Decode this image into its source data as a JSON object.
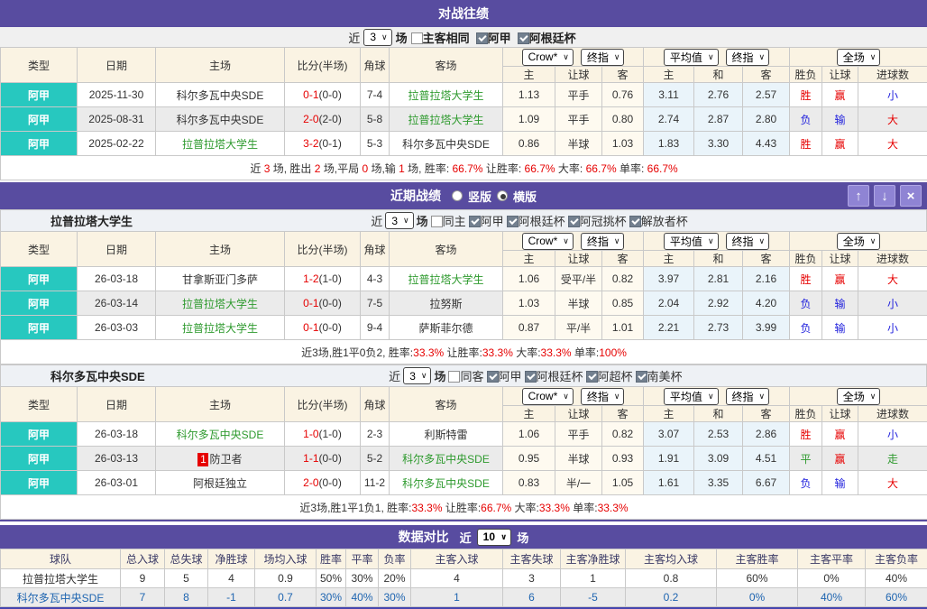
{
  "colors": {
    "purple": "#584CA0",
    "teal": "#27C8BF",
    "red": "#E60000",
    "blue": "#2222DD",
    "green": "#2E9A2E",
    "header_beige": "#FAF3E3",
    "odds_col": "#FEFAF0",
    "avg_col": "#EAF4FA",
    "alt_row": "#EBEBEB",
    "compare_away_text": "#1D64B0"
  },
  "table_headers": {
    "left": [
      "类型",
      "日期",
      "主场",
      "比分(半场)",
      "角球",
      "客场"
    ],
    "right": [
      "主",
      "让球",
      "客",
      "主",
      "和",
      "客",
      "胜负",
      "让球",
      "进球数"
    ]
  },
  "selects": {
    "book": "Crow*",
    "final1": "终指",
    "avg": "平均值",
    "final2": "终指",
    "scope": "全场"
  },
  "h2h": {
    "title": "对战往绩",
    "controls": {
      "prefix": "近",
      "count": "3",
      "suffix": "场",
      "checks": [
        {
          "label": "主客相同",
          "checked": false
        },
        {
          "label": "阿甲",
          "checked": true
        },
        {
          "label": "阿根廷杯",
          "checked": true
        }
      ]
    },
    "rows": [
      {
        "type": "阿甲",
        "date": "2025-11-30",
        "home": {
          "name": "科尔多瓦中央SDE",
          "green": false
        },
        "score": "0-1",
        "half": "(0-0)",
        "corner": "7-4",
        "away": {
          "name": "拉普拉塔大学生",
          "green": true
        },
        "odds": [
          "1.13",
          "平手",
          "0.76"
        ],
        "avg": [
          "3.11",
          "2.76",
          "2.57"
        ],
        "results": [
          {
            "t": "胜",
            "c": "red"
          },
          {
            "t": "赢",
            "c": "red"
          },
          {
            "t": "小",
            "c": "blue"
          }
        ]
      },
      {
        "type": "阿甲",
        "date": "2025-08-31",
        "home": {
          "name": "科尔多瓦中央SDE",
          "green": false
        },
        "score": "2-0",
        "half": "(2-0)",
        "corner": "5-8",
        "away": {
          "name": "拉普拉塔大学生",
          "green": true
        },
        "odds": [
          "1.09",
          "平手",
          "0.80"
        ],
        "avg": [
          "2.74",
          "2.87",
          "2.80"
        ],
        "results": [
          {
            "t": "负",
            "c": "blue"
          },
          {
            "t": "输",
            "c": "blue"
          },
          {
            "t": "大",
            "c": "red"
          }
        ]
      },
      {
        "type": "阿甲",
        "date": "2025-02-22",
        "home": {
          "name": "拉普拉塔大学生",
          "green": true
        },
        "score": "3-2",
        "half": "(0-1)",
        "corner": "5-3",
        "away": {
          "name": "科尔多瓦中央SDE",
          "green": false
        },
        "odds": [
          "0.86",
          "半球",
          "1.03"
        ],
        "avg": [
          "1.83",
          "3.30",
          "4.43"
        ],
        "results": [
          {
            "t": "胜",
            "c": "red"
          },
          {
            "t": "赢",
            "c": "red"
          },
          {
            "t": "大",
            "c": "red"
          }
        ]
      }
    ],
    "summary": [
      {
        "t": "近 ",
        "r": false
      },
      {
        "t": "3",
        "r": true
      },
      {
        "t": " 场, 胜出 ",
        "r": false
      },
      {
        "t": "2",
        "r": true
      },
      {
        "t": " 场,平局 ",
        "r": false
      },
      {
        "t": "0",
        "r": true
      },
      {
        "t": " 场,输 ",
        "r": false
      },
      {
        "t": "1",
        "r": true
      },
      {
        "t": " 场, 胜率: ",
        "r": false
      },
      {
        "t": "66.7%",
        "r": true
      },
      {
        "t": " 让胜率: ",
        "r": false
      },
      {
        "t": "66.7%",
        "r": true
      },
      {
        "t": " 大率: ",
        "r": false
      },
      {
        "t": "66.7%",
        "r": true
      },
      {
        "t": " 单率: ",
        "r": false
      },
      {
        "t": "66.7%",
        "r": true
      }
    ]
  },
  "recent": {
    "title": "近期战绩",
    "radios": [
      {
        "label": "竖版",
        "selected": false
      },
      {
        "label": "横版",
        "selected": true
      }
    ],
    "buttons": [
      {
        "name": "move-up-button",
        "glyph": "↑"
      },
      {
        "name": "move-down-button",
        "glyph": "↓"
      },
      {
        "name": "close-button",
        "glyph": "×"
      }
    ],
    "teams": [
      {
        "name": "拉普拉塔大学生",
        "controls": {
          "prefix": "近",
          "count": "3",
          "suffix": "场",
          "checks": [
            {
              "label": "同主",
              "checked": false
            },
            {
              "label": "阿甲",
              "checked": true
            },
            {
              "label": "阿根廷杯",
              "checked": true
            },
            {
              "label": "阿冠挑杯",
              "checked": true
            },
            {
              "label": "解放者杯",
              "checked": true
            }
          ]
        },
        "rows": [
          {
            "type": "阿甲",
            "date": "26-03-18",
            "home": {
              "name": "甘拿斯亚门多萨",
              "green": false
            },
            "score": "1-2",
            "half": "(1-0)",
            "corner": "4-3",
            "away": {
              "name": "拉普拉塔大学生",
              "green": true
            },
            "odds": [
              "1.06",
              "受平/半",
              "0.82"
            ],
            "avg": [
              "3.97",
              "2.81",
              "2.16"
            ],
            "results": [
              {
                "t": "胜",
                "c": "red"
              },
              {
                "t": "赢",
                "c": "red"
              },
              {
                "t": "大",
                "c": "red"
              }
            ]
          },
          {
            "type": "阿甲",
            "date": "26-03-14",
            "home": {
              "name": "拉普拉塔大学生",
              "green": true
            },
            "score": "0-1",
            "half": "(0-0)",
            "corner": "7-5",
            "away": {
              "name": "拉努斯",
              "green": false
            },
            "odds": [
              "1.03",
              "半球",
              "0.85"
            ],
            "avg": [
              "2.04",
              "2.92",
              "4.20"
            ],
            "results": [
              {
                "t": "负",
                "c": "blue"
              },
              {
                "t": "输",
                "c": "blue"
              },
              {
                "t": "小",
                "c": "blue"
              }
            ]
          },
          {
            "type": "阿甲",
            "date": "26-03-03",
            "home": {
              "name": "拉普拉塔大学生",
              "green": true
            },
            "score": "0-1",
            "half": "(0-0)",
            "corner": "9-4",
            "away": {
              "name": "萨斯菲尔德",
              "green": false
            },
            "odds": [
              "0.87",
              "平/半",
              "1.01"
            ],
            "avg": [
              "2.21",
              "2.73",
              "3.99"
            ],
            "results": [
              {
                "t": "负",
                "c": "blue"
              },
              {
                "t": "输",
                "c": "blue"
              },
              {
                "t": "小",
                "c": "blue"
              }
            ]
          }
        ],
        "summary": [
          {
            "t": "近3场,胜1平0负2, 胜率:",
            "r": false
          },
          {
            "t": "33.3%",
            "r": true
          },
          {
            "t": " 让胜率:",
            "r": false
          },
          {
            "t": "33.3%",
            "r": true
          },
          {
            "t": " 大率:",
            "r": false
          },
          {
            "t": "33.3%",
            "r": true
          },
          {
            "t": " 单率:",
            "r": false
          },
          {
            "t": "100%",
            "r": true
          }
        ]
      },
      {
        "name": "科尔多瓦中央SDE",
        "controls": {
          "prefix": "近",
          "count": "3",
          "suffix": "场",
          "checks": [
            {
              "label": "同客",
              "checked": false
            },
            {
              "label": "阿甲",
              "checked": true
            },
            {
              "label": "阿根廷杯",
              "checked": true
            },
            {
              "label": "阿超杯",
              "checked": true
            },
            {
              "label": "南美杯",
              "checked": true
            }
          ]
        },
        "rows": [
          {
            "type": "阿甲",
            "date": "26-03-18",
            "home": {
              "name": "科尔多瓦中央SDE",
              "green": true
            },
            "score": "1-0",
            "half": "(1-0)",
            "corner": "2-3",
            "away": {
              "name": "利斯特雷",
              "green": false
            },
            "odds": [
              "1.06",
              "平手",
              "0.82"
            ],
            "avg": [
              "3.07",
              "2.53",
              "2.86"
            ],
            "results": [
              {
                "t": "胜",
                "c": "red"
              },
              {
                "t": "赢",
                "c": "red"
              },
              {
                "t": "小",
                "c": "blue"
              }
            ]
          },
          {
            "type": "阿甲",
            "date": "26-03-13",
            "home": {
              "name": "防卫者",
              "green": false,
              "badge": "1"
            },
            "score": "1-1",
            "half": "(0-0)",
            "corner": "5-2",
            "away": {
              "name": "科尔多瓦中央SDE",
              "green": true
            },
            "odds": [
              "0.95",
              "半球",
              "0.93"
            ],
            "avg": [
              "1.91",
              "3.09",
              "4.51"
            ],
            "results": [
              {
                "t": "平",
                "c": "green"
              },
              {
                "t": "赢",
                "c": "red"
              },
              {
                "t": "走",
                "c": "green"
              }
            ]
          },
          {
            "type": "阿甲",
            "date": "26-03-01",
            "home": {
              "name": "阿根廷独立",
              "green": false
            },
            "score": "2-0",
            "half": "(0-0)",
            "corner": "11-2",
            "away": {
              "name": "科尔多瓦中央SDE",
              "green": true
            },
            "odds": [
              "0.83",
              "半/一",
              "1.05"
            ],
            "avg": [
              "1.61",
              "3.35",
              "6.67"
            ],
            "results": [
              {
                "t": "负",
                "c": "blue"
              },
              {
                "t": "输",
                "c": "blue"
              },
              {
                "t": "大",
                "c": "red"
              }
            ]
          }
        ],
        "summary": [
          {
            "t": "近3场,胜1平1负1, 胜率:",
            "r": false
          },
          {
            "t": "33.3%",
            "r": true
          },
          {
            "t": " 让胜率:",
            "r": false
          },
          {
            "t": "66.7%",
            "r": true
          },
          {
            "t": " 大率:",
            "r": false
          },
          {
            "t": "33.3%",
            "r": true
          },
          {
            "t": " 单率:",
            "r": false
          },
          {
            "t": "33.3%",
            "r": true
          }
        ]
      }
    ]
  },
  "comparison": {
    "title": "数据对比",
    "prefix": "近",
    "count": "10",
    "suffix": "场",
    "headers": [
      "球队",
      "总入球",
      "总失球",
      "净胜球",
      "场均入球",
      "胜率",
      "平率",
      "负率",
      "主客入球",
      "主客失球",
      "主客净胜球",
      "主客均入球",
      "主客胜率",
      "主客平率",
      "主客负率"
    ],
    "rows": [
      {
        "team": "拉普拉塔大学生",
        "values": [
          "9",
          "5",
          "4",
          "0.9",
          "50%",
          "30%",
          "20%",
          "4",
          "3",
          "1",
          "0.8",
          "60%",
          "0%",
          "40%"
        ],
        "highlight": false
      },
      {
        "team": "科尔多瓦中央SDE",
        "values": [
          "7",
          "8",
          "-1",
          "0.7",
          "30%",
          "40%",
          "30%",
          "1",
          "6",
          "-5",
          "0.2",
          "0%",
          "40%",
          "60%"
        ],
        "highlight": true
      }
    ]
  }
}
